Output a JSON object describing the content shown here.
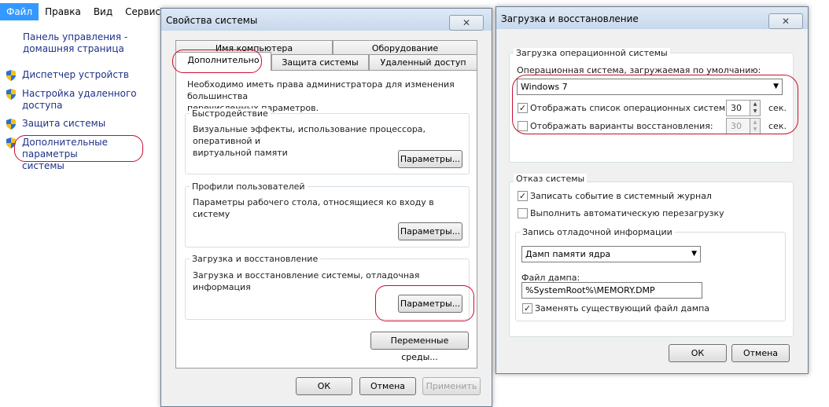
{
  "left_pane": {
    "menu": [
      "Файл",
      "Правка",
      "Вид",
      "Сервис"
    ],
    "home_link_line1": "Панель управления -",
    "home_link_line2": "домашняя страница",
    "links": [
      {
        "line1": "Диспетчер устройств",
        "line2": ""
      },
      {
        "line1": "Настройка удаленного",
        "line2": "доступа"
      },
      {
        "line1": "Защита системы",
        "line2": ""
      },
      {
        "line1": "Дополнительные параметры",
        "line2": "системы"
      }
    ]
  },
  "sys_props": {
    "title": "Свойства системы",
    "close": "✕",
    "tabs_row1": [
      "Имя компьютера",
      "Оборудование"
    ],
    "tabs_row2": [
      "Дополнительно",
      "Защита системы",
      "Удаленный доступ"
    ],
    "admin_note_line1": "Необходимо иметь права администратора для изменения большинства",
    "admin_note_line2": "перечисленных параметров.",
    "performance": {
      "label": "Быстродействие",
      "desc_line1": "Визуальные эффекты, использование процессора, оперативной и",
      "desc_line2": "виртуальной памяти",
      "button": "Параметры..."
    },
    "profiles": {
      "label": "Профили пользователей",
      "desc_line1": "Параметры рабочего стола, относящиеся ко входу в систему",
      "button": "Параметры..."
    },
    "startup": {
      "label": "Загрузка и восстановление",
      "desc_line1": "Загрузка и восстановление системы, отладочная информация",
      "button": "Параметры..."
    },
    "env_button": "Переменные среды...",
    "ok": "ОК",
    "cancel": "Отмена",
    "apply": "Применить"
  },
  "boot_recovery": {
    "title": "Загрузка и восстановление",
    "close": "✕",
    "boot_group": {
      "label": "Загрузка операционной системы",
      "default_os_label": "Операционная система, загружаемая по умолчанию:",
      "default_os_value": "Windows 7",
      "show_list_label": "Отображать список операционных систем:",
      "show_list_checked": true,
      "show_list_value": "30",
      "show_recovery_label": "Отображать варианты восстановления:",
      "show_recovery_checked": false,
      "show_recovery_value": "30",
      "sec": "сек."
    },
    "failure_group": {
      "label": "Отказ системы",
      "write_event_label": "Записать событие в системный журнал",
      "write_event_checked": true,
      "auto_restart_label": "Выполнить автоматическую перезагрузку",
      "auto_restart_checked": false,
      "debug_group": {
        "label": "Запись отладочной информации",
        "dump_type": "Дамп памяти ядра",
        "dump_file_label": "Файл дампа:",
        "dump_file_value": "%SystemRoot%\\MEMORY.DMP",
        "overwrite_label": "Заменять существующий файл дампа",
        "overwrite_checked": true
      }
    },
    "ok": "ОК",
    "cancel": "Отмена"
  },
  "colors": {
    "menu_active": "#3399ff",
    "link": "#1e3287",
    "highlight_ring": "#c8102e"
  },
  "icons": [
    "shield-icon",
    "close-icon",
    "checkbox-checked-icon",
    "chevron-down-icon"
  ]
}
